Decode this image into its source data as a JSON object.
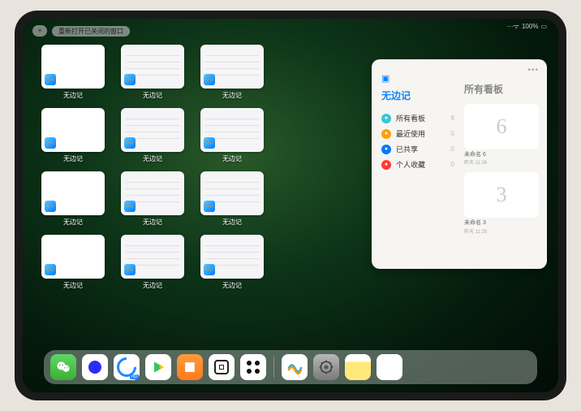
{
  "status": {
    "signal": "•ıll",
    "battery": "100%"
  },
  "topbar": {
    "plus": "+",
    "reopen_label": "重新打开已关闭的窗口"
  },
  "app_name": "无边记",
  "windows": [
    {
      "label": "无边记",
      "variant": "blank"
    },
    {
      "label": "无边记",
      "variant": "content"
    },
    {
      "label": "无边记",
      "variant": "content"
    },
    {
      "label": "无边记",
      "variant": "blank"
    },
    {
      "label": "无边记",
      "variant": "content"
    },
    {
      "label": "无边记",
      "variant": "content"
    },
    {
      "label": "无边记",
      "variant": "blank"
    },
    {
      "label": "无边记",
      "variant": "content"
    },
    {
      "label": "无边记",
      "variant": "content"
    },
    {
      "label": "无边记",
      "variant": "blank"
    },
    {
      "label": "无边记",
      "variant": "content"
    },
    {
      "label": "无边记",
      "variant": "content"
    }
  ],
  "panel": {
    "left_title": "无边记",
    "right_title": "所有看板",
    "items": [
      {
        "icon_color": "c-cyan",
        "label": "所有看板",
        "count": "8"
      },
      {
        "icon_color": "c-orange",
        "label": "最近使用",
        "count": "0"
      },
      {
        "icon_color": "c-blue",
        "label": "已共享",
        "count": "0"
      },
      {
        "icon_color": "c-red",
        "label": "个人收藏",
        "count": "0"
      }
    ],
    "boards": [
      {
        "glyph": "6",
        "name": "未命名 6",
        "time": "昨天 11:26"
      },
      {
        "glyph": "3",
        "name": "未命名 3",
        "time": "昨天 11:25"
      }
    ]
  },
  "dock": {
    "apps": [
      {
        "name": "wechat"
      },
      {
        "name": "blue-circle-app"
      },
      {
        "name": "qq-browser"
      },
      {
        "name": "play-store"
      },
      {
        "name": "books"
      },
      {
        "name": "dice-app"
      },
      {
        "name": "dots-app"
      }
    ],
    "recent": [
      {
        "name": "freeform"
      },
      {
        "name": "settings"
      },
      {
        "name": "notes"
      },
      {
        "name": "app-library"
      }
    ]
  }
}
